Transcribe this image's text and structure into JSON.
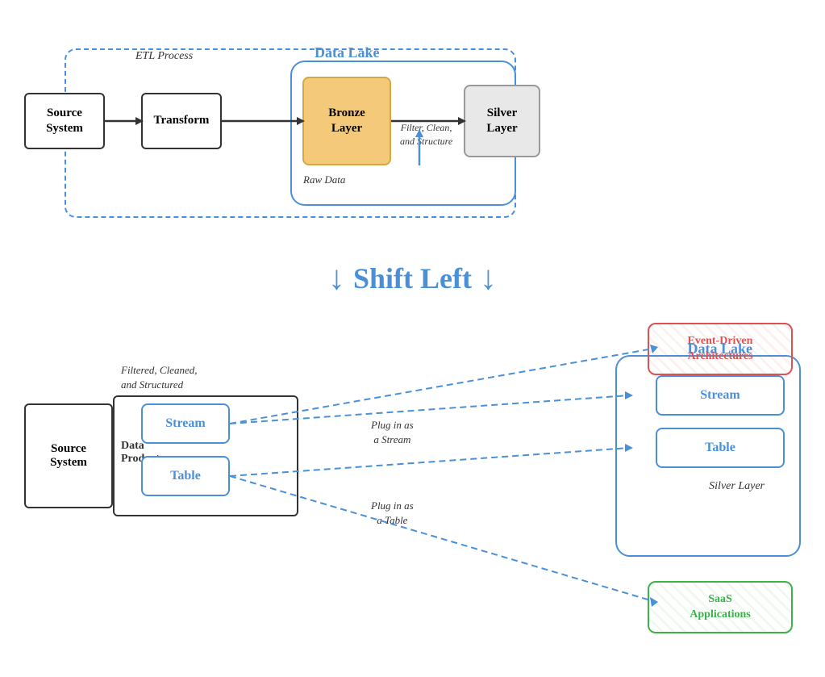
{
  "top": {
    "etl_label": "ETL Process",
    "data_lake_label": "Data Lake",
    "source_system": "Source\nSystem",
    "transform": "Transform",
    "bronze_layer": "Bronze\nLayer",
    "raw_data": "Raw Data",
    "silver_layer": "Silver\nLayer",
    "filter_label": "Filter, Clean,\nand Structure"
  },
  "middle": {
    "shift_left": "Shift Left"
  },
  "bottom": {
    "filtered_label": "Filtered, Cleaned,\nand Structured",
    "source_system": "Source\nSystem",
    "data_product": "Data\nProduct",
    "stream_left": "Stream",
    "table_left": "Table",
    "plug_stream": "Plug in as\na Stream",
    "plug_table": "Plug in as\na Table",
    "data_lake_label": "Data Lake",
    "stream_right": "Stream",
    "table_right": "Table",
    "silver_layer": "Silver Layer",
    "event_driven": "Event-Driven\nArchitectures",
    "saas": "SaaS\nApplications"
  }
}
